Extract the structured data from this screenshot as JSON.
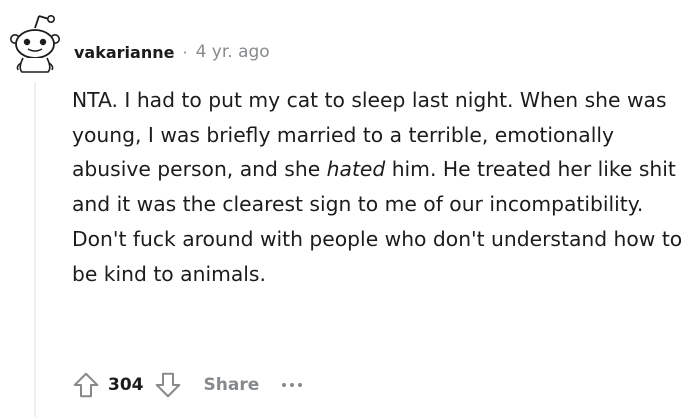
{
  "comment": {
    "username": "vakarianne",
    "separator": "·",
    "timestamp": "4 yr. ago",
    "body": {
      "part1": "NTA. I had to put my cat to sleep last night. When she was young, I was briefly married to a terrible, emotionally abusive person, and she ",
      "emphasis": "hated",
      "part2": " him. He treated her like shit and it was the clearest sign to me of our incompatibility. Don't fuck around with people who don't understand how to be kind to animals."
    },
    "actions": {
      "score": "304",
      "share_label": "Share"
    }
  },
  "icons": {
    "avatar": "reddit-snoo-avatar",
    "upvote": "upvote-arrow-icon",
    "downvote": "downvote-arrow-icon",
    "more": "more-options-icon"
  },
  "colors": {
    "text": "#1c1c1c",
    "muted": "#878a8c",
    "thread_line": "#edeff1"
  }
}
